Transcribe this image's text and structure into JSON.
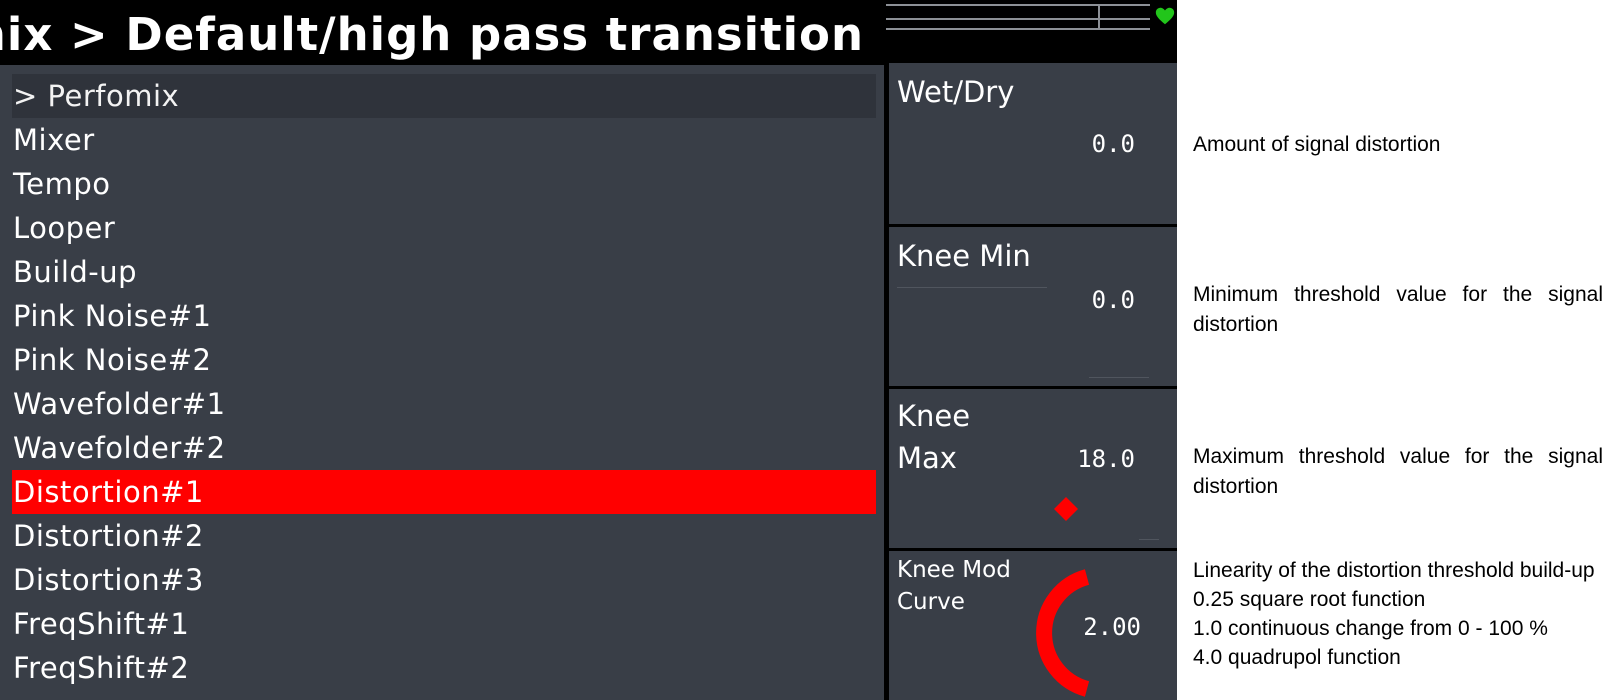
{
  "header": {
    "title": "Perfomix > Default/high pass transition"
  },
  "colors": {
    "panel": "#393e47",
    "selected": "#ff0000",
    "accent_red": "#ff0000",
    "heart_green": "#22c51b"
  },
  "menu": {
    "items": [
      {
        "label": "> Perfomix",
        "state": "current"
      },
      {
        "label": "Mixer",
        "state": "normal"
      },
      {
        "label": "Tempo",
        "state": "normal"
      },
      {
        "label": "Looper",
        "state": "normal"
      },
      {
        "label": "Build-up",
        "state": "normal"
      },
      {
        "label": "Pink Noise#1",
        "state": "normal"
      },
      {
        "label": "Pink Noise#2",
        "state": "normal"
      },
      {
        "label": "Wavefolder#1",
        "state": "normal"
      },
      {
        "label": "Wavefolder#2",
        "state": "normal"
      },
      {
        "label": "Distortion#1",
        "state": "selected"
      },
      {
        "label": "Distortion#2",
        "state": "normal"
      },
      {
        "label": "Distortion#3",
        "state": "normal"
      },
      {
        "label": "FreqShift#1",
        "state": "normal"
      },
      {
        "label": "FreqShift#2",
        "state": "normal"
      }
    ]
  },
  "params": {
    "wet_dry": {
      "label": "Wet/Dry",
      "value": "0.0"
    },
    "knee_min": {
      "label": "Knee Min",
      "value": "0.0"
    },
    "knee_max": {
      "label_line1": "Knee",
      "label_line2": "Max",
      "value": "18.0"
    },
    "knee_mod_curve": {
      "label_line1": "Knee Mod",
      "label_line2": "Curve",
      "value": "2.00"
    }
  },
  "icons": {
    "status": "heart-icon",
    "knee_max_marker": "diamond-marker-icon",
    "curve_knob": "arc-knob-icon"
  },
  "annotations": {
    "wet_dry": [
      "Amount of signal distortion"
    ],
    "knee_min": [
      "Minimum threshold value for the signal distortion"
    ],
    "knee_max": [
      "Maximum threshold value for the signal distortion"
    ],
    "knee_mod_curve": [
      "Linearity of the distortion threshold build-up",
      "0.25 square root function",
      "1.0 continuous change from 0 - 100 %",
      "4.0 quadrupol function"
    ]
  }
}
